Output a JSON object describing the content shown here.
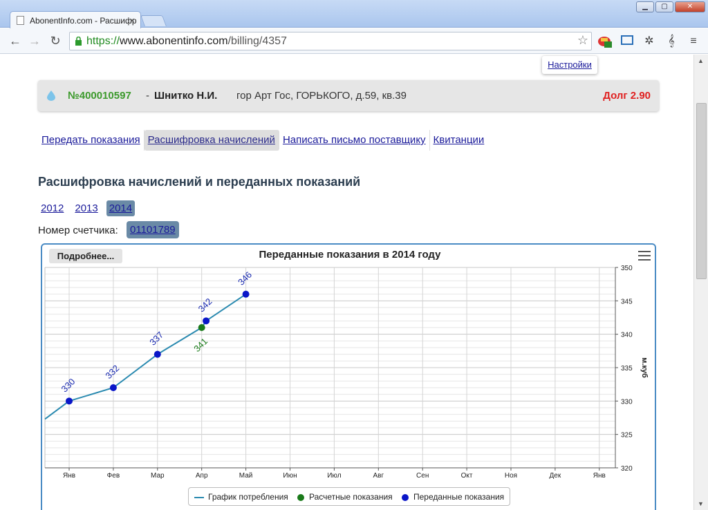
{
  "browser": {
    "tab_title": "AbonentInfo.com - Расшифр",
    "tab_close": "×",
    "url_scheme": "https://",
    "url_host": "www.abonentinfo.com",
    "url_path": "/billing/4357"
  },
  "settings_popup": {
    "label": "Настройки"
  },
  "account": {
    "number": "№400010597",
    "dash": "-",
    "name": "Шнитко Н.И.",
    "address": "гор Арт Гос, ГОРЬКОГО, д.59, кв.39",
    "debt": "Долг 2.90"
  },
  "menu": {
    "items": [
      {
        "label": "Передать показания"
      },
      {
        "label": "Расшифровка начислений"
      },
      {
        "label": "Написать письмо поставщику"
      },
      {
        "label": "Квитанции"
      }
    ]
  },
  "section_title": "Расшифровка начислений и переданных показаний",
  "years": [
    "2012",
    "2013",
    "2014"
  ],
  "meter": {
    "label": "Номер счетчика:",
    "number": "01101789"
  },
  "chart": {
    "more_button": "Подробнее...",
    "legend": {
      "line": "График потребления",
      "calc": "Расчетные показания",
      "sent": "Переданные показания"
    }
  },
  "colors": {
    "line": "#2a8ab0",
    "calc_point": "#1a7a1a",
    "sent_point": "#0a16c8",
    "debt": "#e02020",
    "account_green": "#3c9a2c"
  },
  "chart_data": {
    "type": "line",
    "title": "Переданные показания в 2014 году",
    "categories": [
      "Янв",
      "Фев",
      "Мар",
      "Апр",
      "Май",
      "Июн",
      "Июл",
      "Авг",
      "Сен",
      "Окт",
      "Ноя",
      "Дек",
      "Янв"
    ],
    "ylabel": "м.куб",
    "ylim": [
      320,
      350
    ],
    "yticks": [
      320,
      325,
      330,
      335,
      340,
      345,
      350
    ],
    "series": [
      {
        "name": "Переданные показания",
        "points": [
          {
            "x": "Янв",
            "y": 330,
            "label": "330"
          },
          {
            "x": "Фев",
            "y": 332,
            "label": "332"
          },
          {
            "x": "Мар",
            "y": 337,
            "label": "337"
          },
          {
            "x": "Апр",
            "y": 342,
            "label": "342",
            "offset": 0.1
          },
          {
            "x": "Май",
            "y": 346,
            "label": "346"
          }
        ]
      },
      {
        "name": "Расчетные показания",
        "points": [
          {
            "x": "Апр",
            "y": 341,
            "label": "341"
          }
        ]
      },
      {
        "name": "График потребления",
        "line_y_at_left_edge": 327.3
      }
    ],
    "grid": true
  }
}
